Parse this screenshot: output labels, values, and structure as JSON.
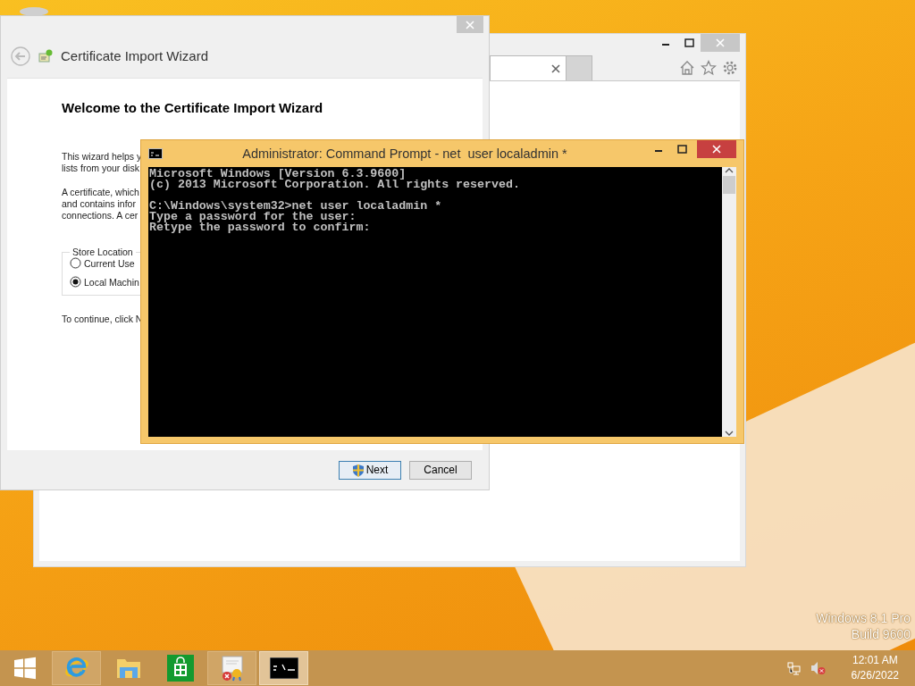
{
  "desktop": {
    "watermark": [
      "Windows 8.1 Pro",
      "Build 9600"
    ]
  },
  "browser_window": {
    "tab": {
      "selected": true
    }
  },
  "wizard_window": {
    "title": "Certificate Import Wizard",
    "heading": "Welcome to the Certificate Import Wizard",
    "paragraphs": [
      [
        "This wizard helps y",
        "lists from your disk"
      ],
      [
        "A certificate, which",
        "and contains infor",
        "connections. A cer"
      ]
    ],
    "store_location": {
      "label": "Store Location",
      "options": [
        {
          "label": "Current Use",
          "selected": false
        },
        {
          "label": "Local Machin",
          "selected": true
        }
      ]
    },
    "footer_text": "To continue, click N",
    "buttons": [
      {
        "label": "Next",
        "default": true,
        "shield": true
      },
      {
        "label": "Cancel",
        "default": false,
        "shield": false
      }
    ]
  },
  "console_window": {
    "title": "Administrator: Command Prompt - net  user localadmin *",
    "blocks": [
      [
        "Microsoft Windows [Version 6.3.9600]",
        "(c) 2013 Microsoft Corporation. All rights reserved."
      ],
      [
        "C:\\Windows\\system32>net user localadmin *",
        "Type a password for the user:",
        "Retype the password to confirm:"
      ]
    ]
  },
  "taskbar": {
    "apps": [
      {
        "kind": "start",
        "running": false,
        "selected": false
      },
      {
        "kind": "browser",
        "running": true,
        "selected": false
      },
      {
        "kind": "explorer",
        "running": false,
        "selected": false
      },
      {
        "kind": "store",
        "running": false,
        "selected": false
      },
      {
        "kind": "certificate",
        "running": true,
        "selected": false
      },
      {
        "kind": "console",
        "running": true,
        "selected": true
      }
    ],
    "tray": {
      "time": "12:01 AM",
      "date": "6/26/2022"
    }
  }
}
